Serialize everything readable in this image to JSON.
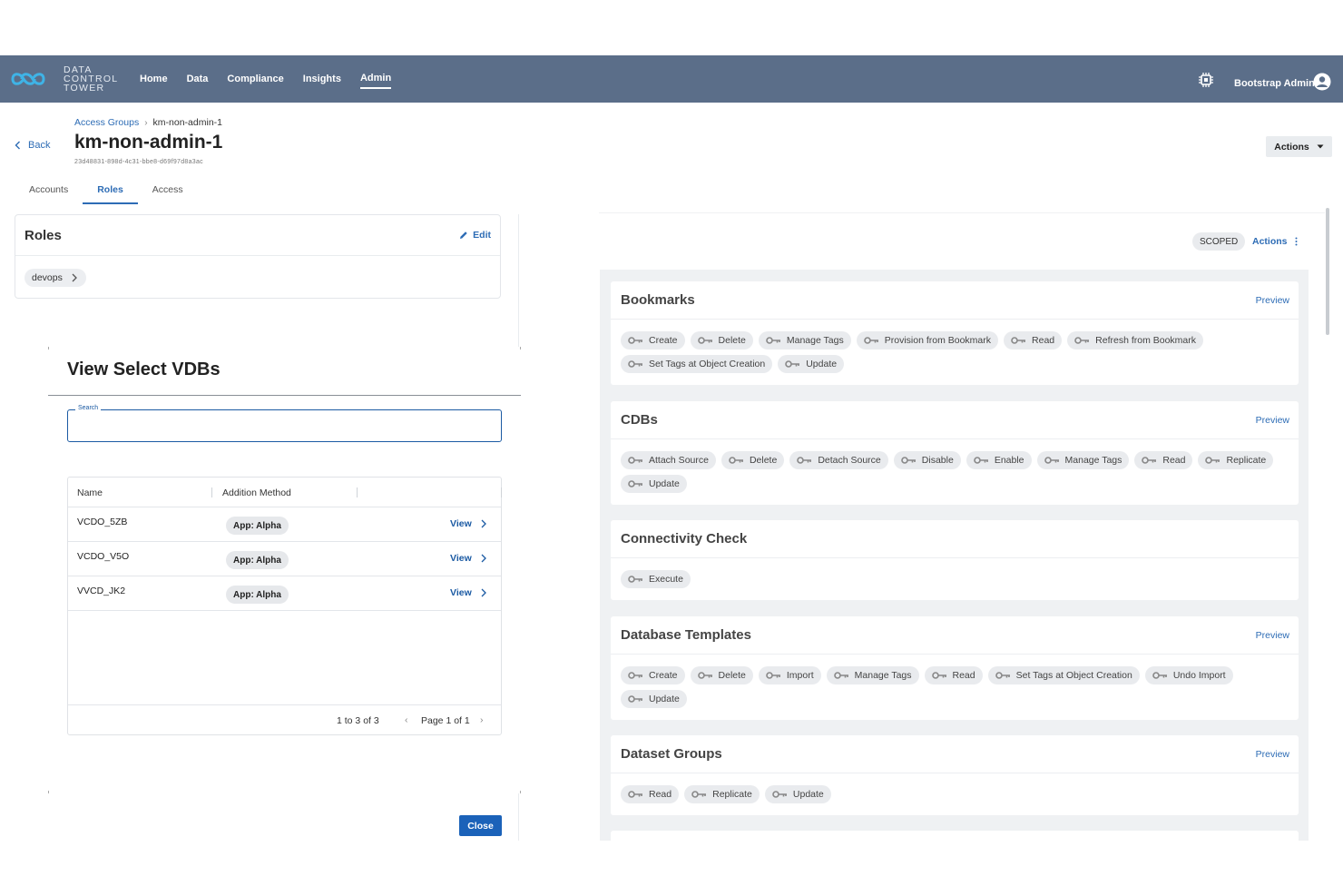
{
  "nav": {
    "brand_lines": [
      "DATA",
      "CONTROL",
      "TOWER"
    ],
    "links": [
      {
        "label": "Home",
        "active": false
      },
      {
        "label": "Data",
        "active": false
      },
      {
        "label": "Compliance",
        "active": false
      },
      {
        "label": "Insights",
        "active": false
      },
      {
        "label": "Admin",
        "active": true
      }
    ],
    "user_name": "Bootstrap Admin",
    "icons": {
      "logo": "dct-logo-icon",
      "settings": "settings-chip-icon",
      "user": "user-circle-icon"
    }
  },
  "header": {
    "back_label": "Back",
    "breadcrumb": {
      "parent": "Access Groups",
      "current": "km-non-admin-1"
    },
    "title": "km-non-admin-1",
    "id": "23d48831-898d-4c31-bbe8-d69f97d8a3ac",
    "actions_label": "Actions"
  },
  "tabs": [
    {
      "label": "Accounts",
      "active": false
    },
    {
      "label": "Roles",
      "active": true
    },
    {
      "label": "Access",
      "active": false
    }
  ],
  "roles_card": {
    "title": "Roles",
    "edit_label": "Edit",
    "chip": "devops"
  },
  "modal": {
    "title": "View Select VDBs",
    "search_label": "Search",
    "search_value": "",
    "columns": [
      "Name",
      "Addition Method"
    ],
    "rows": [
      {
        "name": "VCDO_5ZB",
        "method": "App: Alpha",
        "action": "View"
      },
      {
        "name": "VCDO_V5O",
        "method": "App: Alpha",
        "action": "View"
      },
      {
        "name": "VVCD_JK2",
        "method": "App: Alpha",
        "action": "View"
      }
    ],
    "footer_count": "1 to 3 of 3",
    "footer_page": "Page 1 of 1",
    "close_label": "Close"
  },
  "right_panel": {
    "scoped_label": "SCOPED",
    "actions_label": "Actions",
    "groups": [
      {
        "title": "Bookmarks",
        "preview": "Preview",
        "permissions": [
          "Create",
          "Delete",
          "Manage Tags",
          "Provision from Bookmark",
          "Read",
          "Refresh from Bookmark",
          "Set Tags at Object Creation",
          "Update"
        ]
      },
      {
        "title": "CDBs",
        "preview": "Preview",
        "permissions": [
          "Attach Source",
          "Delete",
          "Detach Source",
          "Disable",
          "Enable",
          "Manage Tags",
          "Read",
          "Replicate",
          "Update"
        ]
      },
      {
        "title": "Connectivity Check",
        "preview": "",
        "permissions": [
          "Execute"
        ]
      },
      {
        "title": "Database Templates",
        "preview": "Preview",
        "permissions": [
          "Create",
          "Delete",
          "Import",
          "Manage Tags",
          "Read",
          "Set Tags at Object Creation",
          "Undo Import",
          "Update"
        ]
      },
      {
        "title": "Dataset Groups",
        "preview": "Preview",
        "permissions": [
          "Read",
          "Replicate",
          "Update"
        ]
      }
    ]
  },
  "colors": {
    "nav_bg": "#5b6e89",
    "link_blue": "#2d6cb5",
    "primary_button": "#1b62b9",
    "panel_bg": "#eff1f3"
  }
}
